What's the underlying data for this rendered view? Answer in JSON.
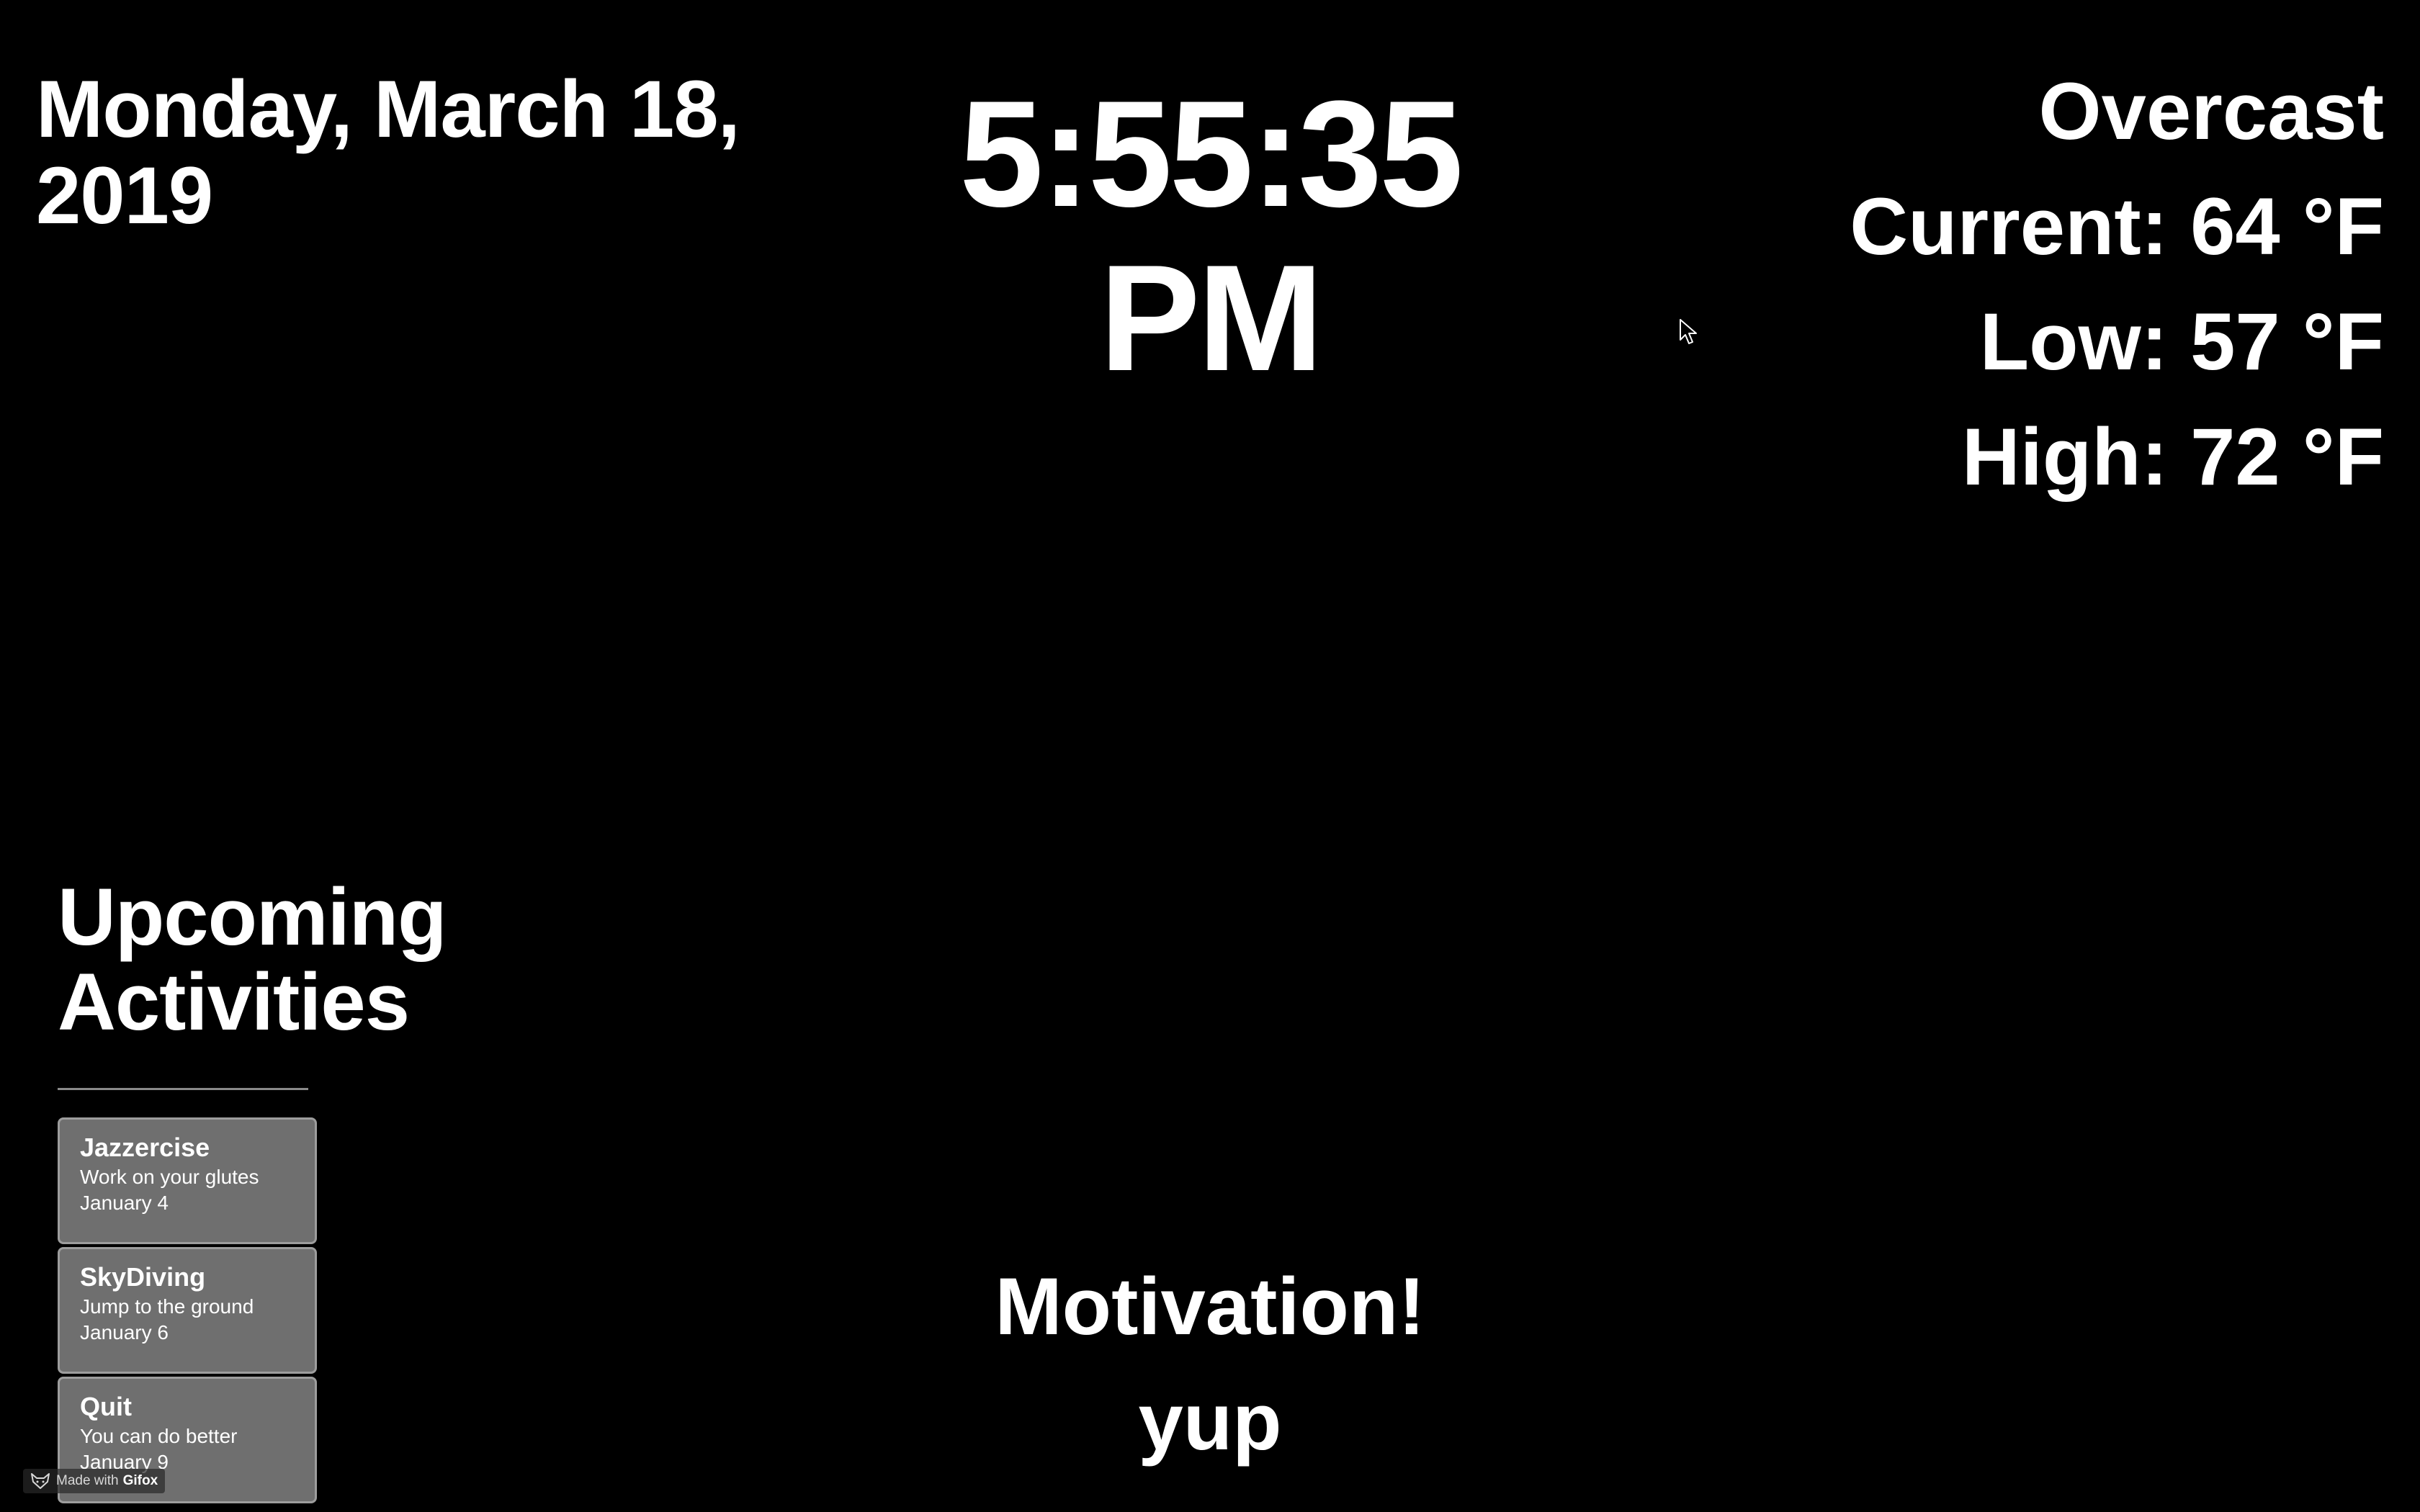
{
  "date": {
    "line1": "Monday, March 18,",
    "line2": "2019"
  },
  "clock": {
    "time": "5:55:35",
    "period": "PM"
  },
  "weather": {
    "condition": "Overcast",
    "current": "Current: 64 °F",
    "low": "Low: 57 °F",
    "high": "High: 72 °F"
  },
  "activities": {
    "heading_line1": "Upcoming",
    "heading_line2": "Activities",
    "items": [
      {
        "title": "Jazzercise",
        "description": "Work on your glutes",
        "date": "January 4"
      },
      {
        "title": "SkyDiving",
        "description": "Jump to the ground",
        "date": "January 6"
      },
      {
        "title": "Quit",
        "description": "You can do better",
        "date": "January 9"
      }
    ]
  },
  "motivation": {
    "title": "Motivation!",
    "quote": "yup"
  },
  "watermark": {
    "prefix": "Made with",
    "brand": "Gifox",
    "icon": "fox-icon"
  },
  "colors": {
    "background": "#000000",
    "text": "#ffffff",
    "card_background": "#6f6f6f",
    "card_border": "#9d9d9d"
  }
}
